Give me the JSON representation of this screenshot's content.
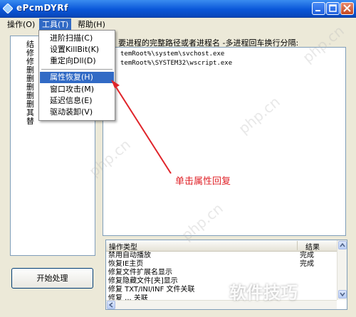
{
  "window": {
    "title": "ePcmDYRf"
  },
  "menubar": [
    {
      "label": "操作(O)"
    },
    {
      "label": "工具(T)"
    },
    {
      "label": "帮助(H)"
    }
  ],
  "tools_menu": {
    "items": [
      {
        "label": "进阶扫描(C)"
      },
      {
        "label": "设置KillBit(K)"
      },
      {
        "label": "重定向Dll(D)"
      },
      {
        "label": "属性恢复(H)",
        "selected": true
      },
      {
        "label": "窗口攻击(M)"
      },
      {
        "label": "延迟信息(E)"
      },
      {
        "label": "驱动装卸(V)"
      }
    ]
  },
  "left_list": [
    "结",
    "修",
    "修",
    "删",
    "删",
    "删",
    "删",
    "删",
    "其",
    "替"
  ],
  "instruction": "要进程的完整路径或者进程名 -多进程回车换行分隔:",
  "process_box": {
    "lines": [
      "temRoot%\\system\\svchost.exe",
      "temRoot%\\SYSTEM32\\wscript.exe"
    ]
  },
  "annotation": {
    "text": "单击属性回复",
    "color": "#e0242a"
  },
  "result_table": {
    "columns": [
      "操作类型",
      "结果"
    ],
    "rows": [
      {
        "type": "禁用自动播放",
        "result": "完成"
      },
      {
        "type": "恢复IE主页",
        "result": "完成"
      },
      {
        "type": "修复文件扩展名显示",
        "result": ""
      },
      {
        "type": "修复隐藏文件[夹]显示",
        "result": ""
      },
      {
        "type": "修复 TXT/INI/INF 文件关联",
        "result": ""
      },
      {
        "type": "修复 ... 关联",
        "result": ""
      }
    ]
  },
  "start_button": {
    "label": "开始处理"
  },
  "watermark": {
    "logo_text": "软件技巧",
    "url_text": "php.cn"
  }
}
